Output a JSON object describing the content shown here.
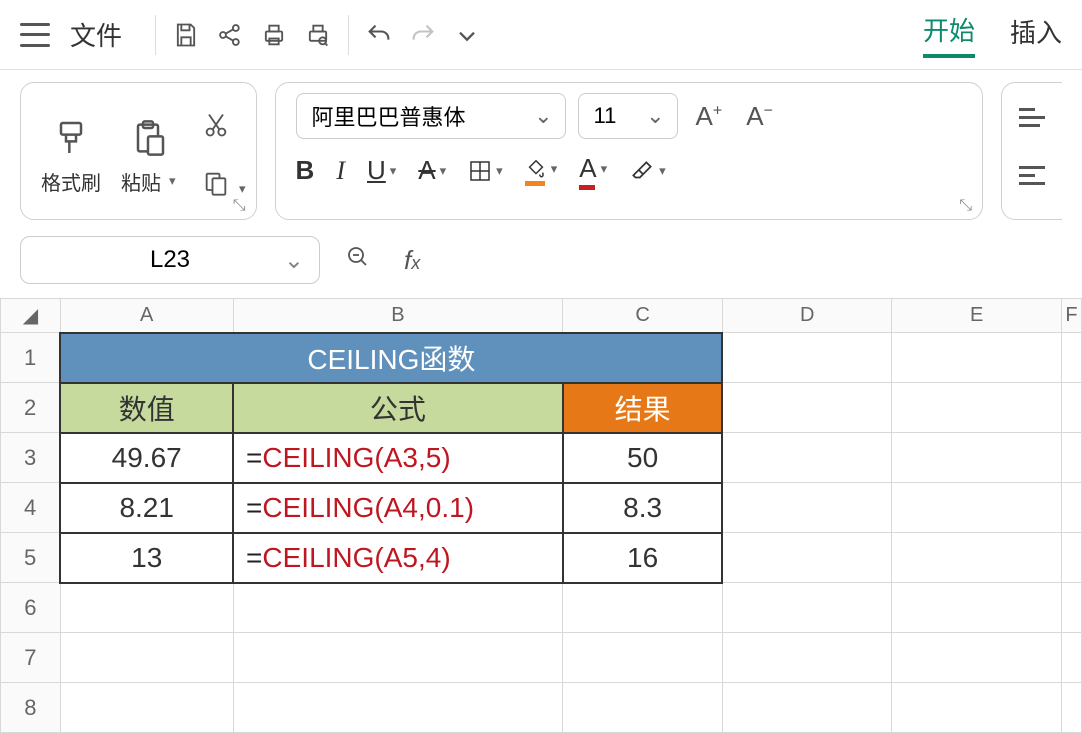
{
  "menu": {
    "file": "文件",
    "tab_start": "开始",
    "tab_insert": "插入"
  },
  "ribbon": {
    "format_painter": "格式刷",
    "paste": "粘贴",
    "font_name": "阿里巴巴普惠体",
    "font_size": "11"
  },
  "formula_bar": {
    "cell_ref": "L23",
    "formula": ""
  },
  "grid": {
    "columns": [
      "A",
      "B",
      "C",
      "D",
      "E",
      "F"
    ],
    "title": "CEILING函数",
    "header_value": "数值",
    "header_formula": "公式",
    "header_result": "结果",
    "rows": [
      {
        "value": "49.67",
        "formula": "CEILING(A3,5)",
        "result": "50"
      },
      {
        "value": "8.21",
        "formula": "CEILING(A4,0.1)",
        "result": "8.3"
      },
      {
        "value": "13",
        "formula": "CEILING(A5,4)",
        "result": "16"
      }
    ]
  }
}
